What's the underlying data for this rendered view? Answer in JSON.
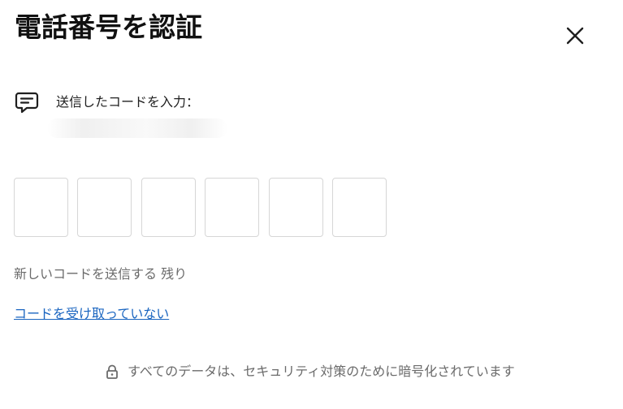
{
  "dialog": {
    "title": "電話番号を認証",
    "close_icon": "close-icon"
  },
  "code_prompt": {
    "icon": "chat-message-icon",
    "label": "送信したコードを入力："
  },
  "otp": {
    "boxes": [
      {
        "value": ""
      },
      {
        "value": ""
      },
      {
        "value": ""
      },
      {
        "value": ""
      },
      {
        "value": ""
      },
      {
        "value": ""
      }
    ]
  },
  "resend": {
    "text": "新しいコードを送信する 残り"
  },
  "help_link": {
    "label": "コードを受け取っていない"
  },
  "security": {
    "icon": "lock-icon",
    "text": "すべてのデータは、セキュリティ対策のために暗号化されています"
  },
  "colors": {
    "link": "#1a65c0",
    "muted_text": "#6b6b6b",
    "box_border": "#d6d6d6"
  }
}
